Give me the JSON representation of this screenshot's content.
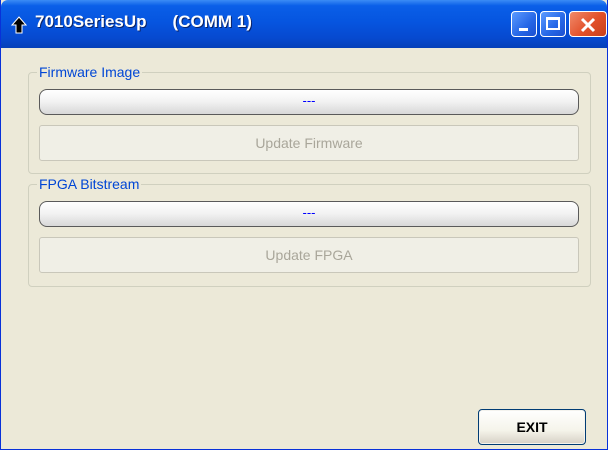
{
  "window": {
    "title": "7010SeriesUp",
    "port": "(COMM 1)",
    "icon": "up-arrow-icon",
    "accent_color": "#0655e0",
    "controls": {
      "minimize_icon": "minimize-icon",
      "maximize_icon": "maximize-icon",
      "close_icon": "close-icon"
    }
  },
  "firmware": {
    "group_label": "Firmware Image",
    "status_text": "---",
    "button_label": "Update Firmware"
  },
  "fpga": {
    "group_label": "FPGA Bitstream",
    "status_text": "---",
    "button_label": "Update FPGA"
  },
  "footer": {
    "exit_label": "EXIT"
  }
}
